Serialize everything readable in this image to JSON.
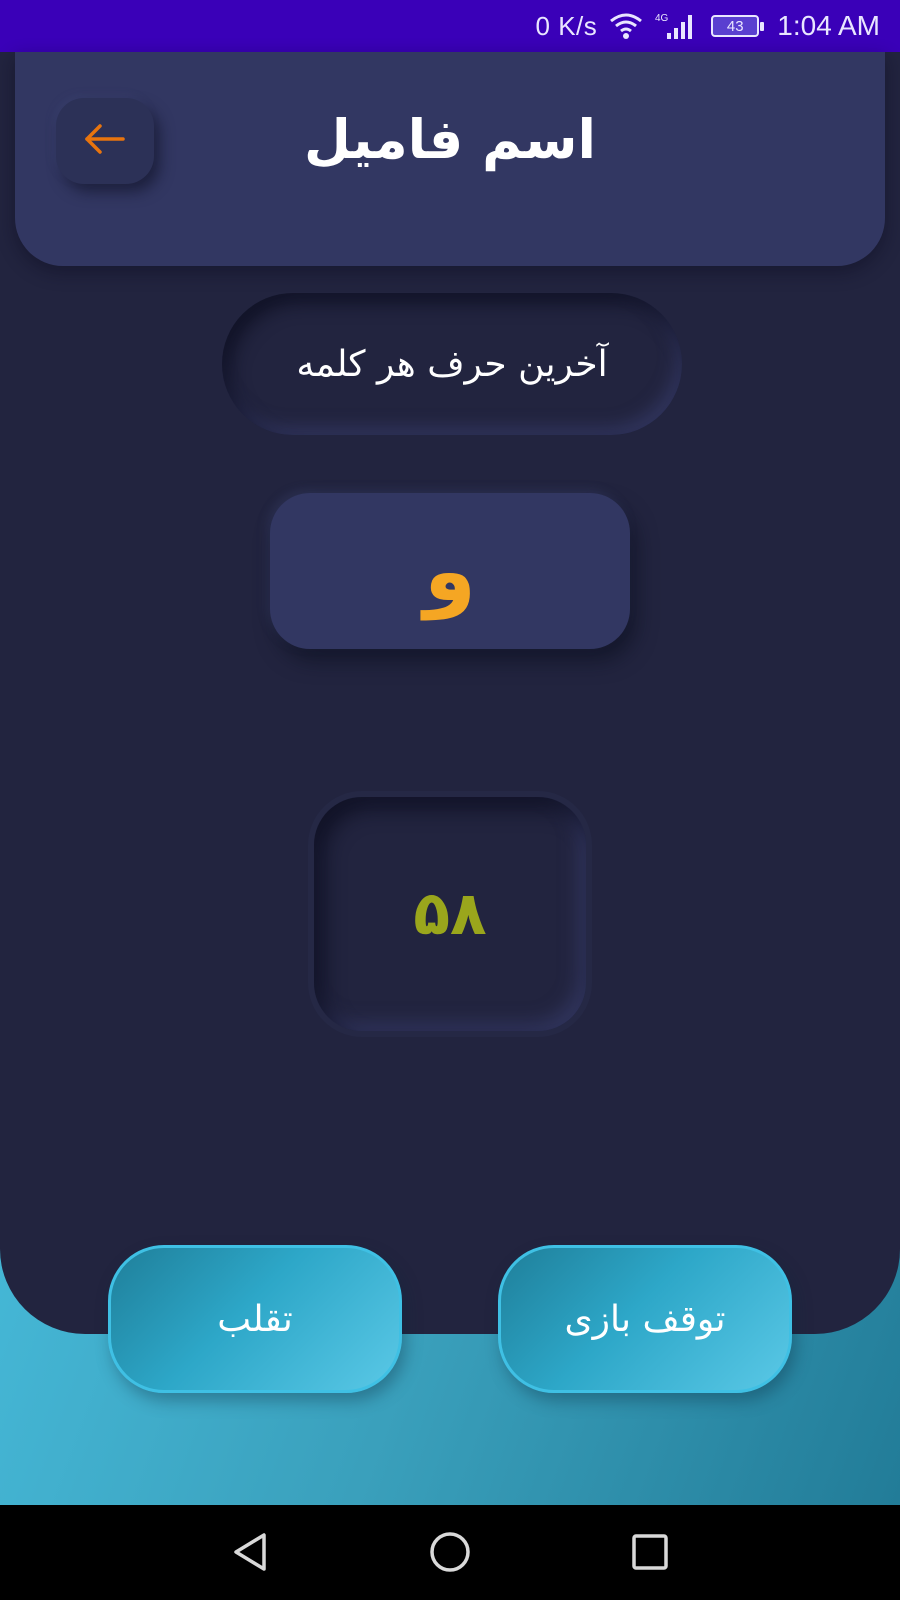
{
  "status_bar": {
    "network_speed": "0 K/s",
    "network_type": "4G",
    "battery": "43",
    "time": "1:04 AM",
    "icons": [
      "wifi-icon",
      "signal-icon",
      "battery-icon"
    ]
  },
  "header": {
    "title": "اسم فامیل",
    "back_icon": "arrow-left-icon"
  },
  "game": {
    "mode_label": "آخرین حرف هر کلمه",
    "letter": "و",
    "timer": "۵۸"
  },
  "actions": {
    "cheat_label": "تقلب",
    "stop_label": "توقف بازی"
  },
  "navigation": {
    "icons": [
      "back-triangle-icon",
      "home-circle-icon",
      "recent-square-icon"
    ]
  },
  "colors": {
    "status_bar": "#3a00b8",
    "background": "#22243f",
    "card": "#323762",
    "accent_orange": "#f5a623",
    "timer_green": "#9aa61c",
    "button_cyan": "#2da7c8"
  }
}
